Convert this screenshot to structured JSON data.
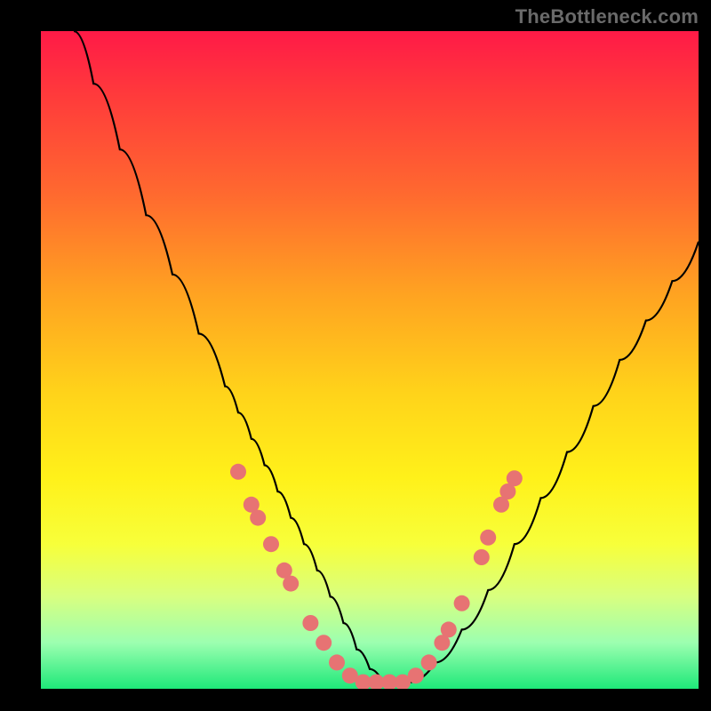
{
  "watermark": "TheBottleneck.com",
  "colors": {
    "frame": "#000000",
    "gradient_top": "#ff1a47",
    "gradient_bottom": "#1ee879",
    "curve": "#000000",
    "dot": "#e77373"
  },
  "chart_data": {
    "type": "line",
    "title": "",
    "xlabel": "",
    "ylabel": "",
    "xlim": [
      0,
      100
    ],
    "ylim": [
      0,
      100
    ],
    "series": [
      {
        "name": "bottleneck-curve",
        "x": [
          5,
          8,
          12,
          16,
          20,
          24,
          28,
          30,
          32,
          34,
          36,
          38,
          40,
          42,
          44,
          46,
          48,
          50,
          52,
          56,
          60,
          64,
          68,
          72,
          76,
          80,
          84,
          88,
          92,
          96,
          100
        ],
        "y": [
          100,
          92,
          82,
          72,
          63,
          54,
          46,
          42,
          38,
          34,
          30,
          26,
          22,
          18,
          14,
          10,
          6,
          3,
          1,
          1,
          4,
          9,
          15,
          22,
          29,
          36,
          43,
          50,
          56,
          62,
          68
        ]
      }
    ],
    "markers": [
      {
        "x": 30,
        "y": 33
      },
      {
        "x": 32,
        "y": 28
      },
      {
        "x": 33,
        "y": 26
      },
      {
        "x": 35,
        "y": 22
      },
      {
        "x": 37,
        "y": 18
      },
      {
        "x": 38,
        "y": 16
      },
      {
        "x": 41,
        "y": 10
      },
      {
        "x": 43,
        "y": 7
      },
      {
        "x": 45,
        "y": 4
      },
      {
        "x": 47,
        "y": 2
      },
      {
        "x": 49,
        "y": 1
      },
      {
        "x": 51,
        "y": 1
      },
      {
        "x": 53,
        "y": 1
      },
      {
        "x": 55,
        "y": 1
      },
      {
        "x": 57,
        "y": 2
      },
      {
        "x": 59,
        "y": 4
      },
      {
        "x": 61,
        "y": 7
      },
      {
        "x": 62,
        "y": 9
      },
      {
        "x": 64,
        "y": 13
      },
      {
        "x": 67,
        "y": 20
      },
      {
        "x": 68,
        "y": 23
      },
      {
        "x": 70,
        "y": 28
      },
      {
        "x": 71,
        "y": 30
      },
      {
        "x": 72,
        "y": 32
      }
    ],
    "marker_radius": 9
  }
}
